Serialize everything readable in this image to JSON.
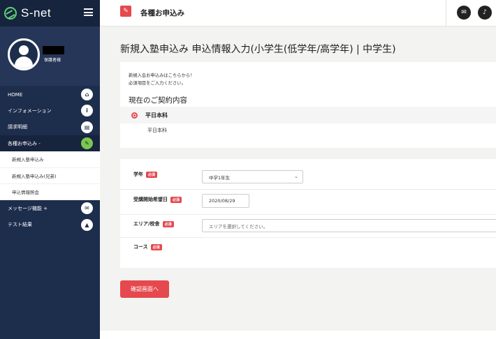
{
  "app": {
    "name": "S-net"
  },
  "profile": {
    "name": "保護者様"
  },
  "nav": {
    "items": [
      {
        "label": "HOME",
        "icon": "home-icon",
        "glyph": "⌂"
      },
      {
        "label": "インフォメーション",
        "icon": "info-icon",
        "glyph": "i"
      },
      {
        "label": "請求明細",
        "icon": "document-icon",
        "glyph": "▤"
      },
      {
        "label": "各種お申込み -",
        "icon": "edit-icon",
        "glyph": "✎"
      }
    ],
    "sub_items": [
      "新規入塾申込み",
      "新規入塾申込み(兄弟)",
      "申込情報照会"
    ],
    "items_after": [
      {
        "label": "メッセージ機能 +",
        "icon": "chat-icon",
        "glyph": "✉"
      },
      {
        "label": "テスト結果",
        "icon": "chart-icon",
        "glyph": "▲"
      }
    ]
  },
  "topbar": {
    "title": "各種お申込み",
    "icon": "edit-icon"
  },
  "page": {
    "title": "新規入塾申込み 申込情報入力(小学生(低学年/高学年) | 中学生)",
    "note_line1": "新規入会お申込みはこちらから！",
    "note_line2": "必須項目をご入力ください。",
    "section_title": "現在のご契約内容",
    "plan_radio_label": "平日本科",
    "plan_text": "平日本科"
  },
  "form": {
    "required_badge": "必須",
    "grade": {
      "label": "学年",
      "value": "中学1年生"
    },
    "start_date": {
      "label": "受講開始希望日",
      "value": "2020/08/29"
    },
    "area": {
      "label": "エリア/校舎",
      "placeholder": "エリアを選択してください。"
    },
    "course": {
      "label": "コース"
    }
  },
  "actions": {
    "confirm_label": "確認画面へ"
  },
  "colors": {
    "accent": "#e5484d",
    "sidebar": "#1d2d4c",
    "active_icon": "#7dc54f"
  }
}
